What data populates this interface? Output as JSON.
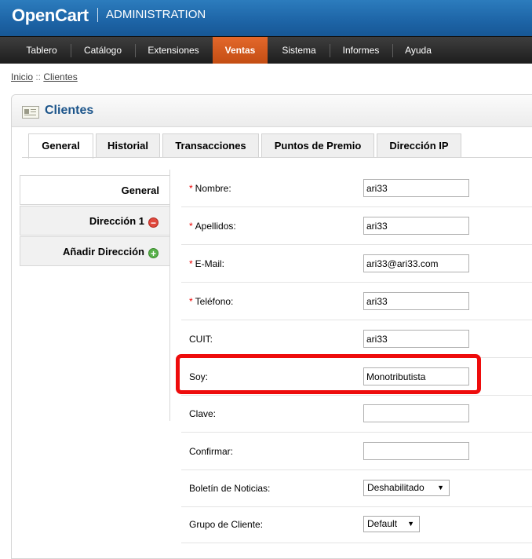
{
  "header": {
    "logo": "OpenCart",
    "subtitle": "ADMINISTRATION"
  },
  "menu": [
    {
      "label": "Tablero"
    },
    {
      "label": "Catálogo"
    },
    {
      "label": "Extensiones"
    },
    {
      "label": "Ventas",
      "active": true
    },
    {
      "label": "Sistema"
    },
    {
      "label": "Informes"
    },
    {
      "label": "Ayuda"
    }
  ],
  "breadcrumb": {
    "home": "Inicio",
    "separator": " :: ",
    "current": "Clientes"
  },
  "box": {
    "title": "Clientes",
    "icon": "customer-card-icon"
  },
  "tabs": [
    "General",
    "Historial",
    "Transacciones",
    "Puntos de Premio",
    "Dirección IP"
  ],
  "vtabs": [
    {
      "label": "General"
    },
    {
      "label": "Dirección 1",
      "icon": "remove-icon"
    },
    {
      "label": "Añadir Dirección",
      "icon": "add-icon"
    }
  ],
  "form": {
    "nombre": {
      "label": "Nombre:",
      "required": "*",
      "value": "ari33"
    },
    "apellidos": {
      "label": "Apellidos:",
      "required": "*",
      "value": "ari33"
    },
    "email": {
      "label": "E-Mail:",
      "required": "*",
      "value": "ari33@ari33.com"
    },
    "telefono": {
      "label": "Teléfono:",
      "required": "*",
      "value": "ari33"
    },
    "cuit": {
      "label": "CUIT:",
      "value": "ari33"
    },
    "soy": {
      "label": "Soy:",
      "value": "Monotributista"
    },
    "clave": {
      "label": "Clave:",
      "value": ""
    },
    "confirmar": {
      "label": "Confirmar:",
      "value": ""
    },
    "boletin": {
      "label": "Boletín de Noticias:",
      "value": "Deshabilitado"
    },
    "grupo": {
      "label": "Grupo de Cliente:",
      "value": "Default"
    }
  },
  "colors": {
    "header_blue": "#1d64a6",
    "menu_active": "#d65a1e",
    "title_blue": "#1b548a",
    "highlight_red": "#ee0c0c",
    "required_red": "#ee0000"
  }
}
